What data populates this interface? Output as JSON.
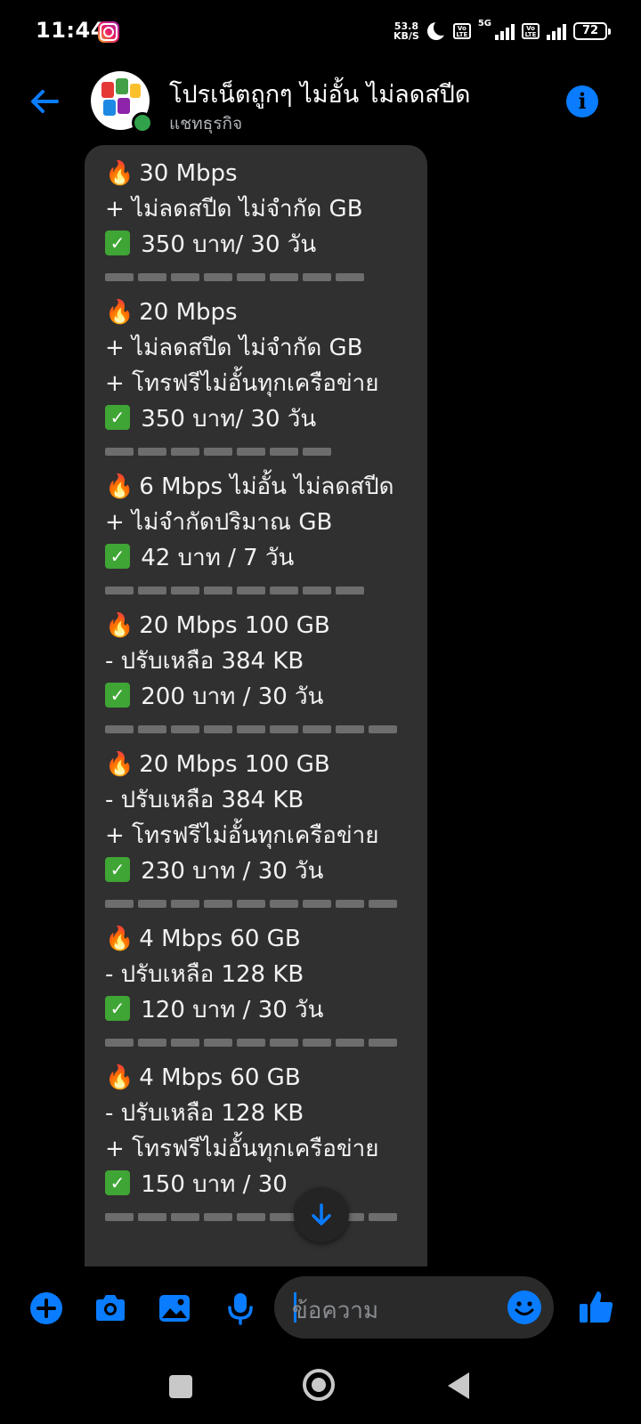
{
  "status_bar": {
    "time": "11:44",
    "net_speed_value": "53.8",
    "net_speed_unit": "KB/S",
    "volte1": "Vo LTE",
    "network_5g": "5G",
    "volte2": "Vo LTE",
    "battery": "72"
  },
  "header": {
    "title": "โปรเน็ตถูกๆ ไม่อั้น ไม่ลดสปีด",
    "subtitle": "แชทธุรกิจ",
    "info_label": "i"
  },
  "message": {
    "fire_emoji": "🔥",
    "check_emoji": "✓",
    "lines": [
      "30 Mbps",
      "+ ไม่ลดสปีด ไม่จำกัด GB",
      "350 บาท/ 30 วัน",
      "20 Mbps",
      "+ ไม่ลดสปีด ไม่จำกัด GB",
      "+ โทรฟรีไม่อั้นทุกเครือข่าย",
      "350 บาท/ 30 วัน",
      "6 Mbps ไม่อั้น ไม่ลดสปีด",
      "+ ไม่จำกัดปริมาณ GB",
      "42 บาท / 7 วัน",
      "20 Mbps 100 GB",
      "- ปรับเหลือ 384 KB",
      "200 บาท / 30 วัน",
      "20 Mbps 100 GB",
      "- ปรับเหลือ 384 KB",
      "+ โทรฟรีไม่อั้นทุกเครือข่าย",
      "230 บาท / 30 วัน",
      "4 Mbps 60 GB",
      "- ปรับเหลือ 128 KB",
      "120 บาท / 30 วัน",
      "4 Mbps 60 GB",
      "- ปรับเหลือ 128 KB",
      "+ โทรฟรีไม่อั้นทุกเครือข่าย",
      "150 บาท / 30"
    ]
  },
  "composer": {
    "placeholder": "ข้อความ"
  },
  "colors": {
    "accent": "#0a7cff",
    "bubble": "#303030",
    "online": "#31a24c",
    "background": "#000000"
  }
}
